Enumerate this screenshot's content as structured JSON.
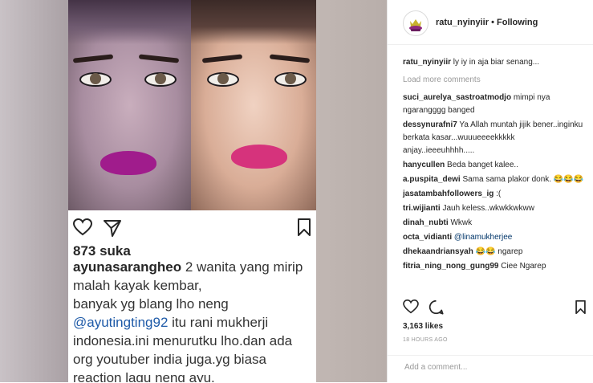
{
  "post_image": {
    "likes_text": "873 suka",
    "caption_user": "ayunasarangheo",
    "caption_line1": " 2 wanita yang mirip malah kayak kembar,",
    "caption_line2": "banyak yg blang lho neng",
    "caption_mention": "@ayutingting92",
    "caption_line3": " itu rani mukherji indonesia.ini menurutku lho.dan ada org youtuber india juga.yg biasa reaction lagu neng ayu."
  },
  "header": {
    "username": "ratu_nyinyiir",
    "separator": " • ",
    "follow_status": "Following"
  },
  "comments": {
    "caption": {
      "user": "ratu_nyinyiir",
      "text": " ly iy in aja biar senang..."
    },
    "load_more": "Load more comments",
    "items": [
      {
        "user": "suci_aurelya_sastroatmodjo",
        "text": " mimpi nya ngarangggg banged"
      },
      {
        "user": "dessynurafni7",
        "text": " Ya Allah muntah jijik bener..inginku berkata kasar...wuuueeeekkkkk anjay..ieeeuhhhh....."
      },
      {
        "user": "hanycullen",
        "text": " Beda banget kalee.."
      },
      {
        "user": "a.puspita_dewi",
        "text": " Sama sama plakor donk. 😂😂😂"
      },
      {
        "user": "jasatambahfollowers_ig",
        "text": " :("
      },
      {
        "user": "tri.wijianti",
        "text": " Jauh keless..wkwkkwkww"
      },
      {
        "user": "dinah_nubti",
        "text": " Wkwk"
      },
      {
        "user": "octa_vidianti",
        "text": " ",
        "mention": "@linamukherjee"
      },
      {
        "user": "dhekaandriansyah",
        "text": " 😂😂 ngarep"
      },
      {
        "user": "fitria_ning_nong_gung99",
        "text": " Ciee Ngarep"
      }
    ]
  },
  "actions": {
    "icons": [
      "heart-icon",
      "comment-icon",
      "bookmark-icon"
    ],
    "likes": "3,163 likes",
    "timestamp": "18 HOURS AGO"
  },
  "add_comment": {
    "placeholder": "Add a comment..."
  },
  "colors": {
    "text": "#262626",
    "muted": "#999999",
    "mention": "#003569",
    "border": "#efefef"
  }
}
